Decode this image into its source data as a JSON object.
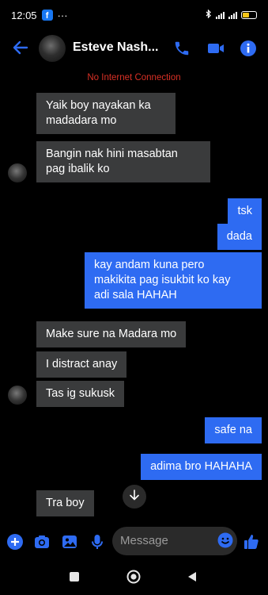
{
  "status_bar": {
    "time": "12:05",
    "dots": "···",
    "battery_level": 0.55
  },
  "header": {
    "contact_name": "Esteve Nash...",
    "icons": [
      "back-arrow-icon",
      "phone-icon",
      "video-camera-icon",
      "info-icon"
    ]
  },
  "banner": {
    "text": "No Internet Connection"
  },
  "messages": [
    {
      "side": "in",
      "lines": [
        "Yaik boy nayakan ka",
        "madadara mo"
      ]
    },
    {
      "side": "in",
      "lines": [
        "Bangin nak hini masabtan",
        "pag ibalik ko"
      ]
    },
    {
      "side": "out",
      "lines": [
        "tsk"
      ]
    },
    {
      "side": "out",
      "lines": [
        "dada"
      ]
    },
    {
      "side": "out",
      "lines": [
        "kay andam kuna pero",
        "makikita pag isukbit ko kay",
        "adi sala HAHAH"
      ]
    },
    {
      "side": "in",
      "lines": [
        "Make sure na Madara mo"
      ]
    },
    {
      "side": "in",
      "lines": [
        "I distract anay"
      ]
    },
    {
      "side": "in",
      "lines": [
        "Tas ig sukusk"
      ]
    },
    {
      "side": "out",
      "lines": [
        "safe na"
      ]
    },
    {
      "side": "out",
      "lines": [
        "adima bro HAHAHA"
      ]
    },
    {
      "side": "in",
      "lines": [
        "Tra boy"
      ]
    }
  ],
  "composer": {
    "placeholder": "Message",
    "icons": [
      "plus-icon",
      "camera-icon",
      "image-icon",
      "microphone-icon",
      "emoji-icon",
      "thumbs-up-icon"
    ]
  },
  "colors": {
    "accent": "#2e6bf2",
    "incoming_bubble": "#3a3b3c",
    "banner": "#d93025"
  }
}
